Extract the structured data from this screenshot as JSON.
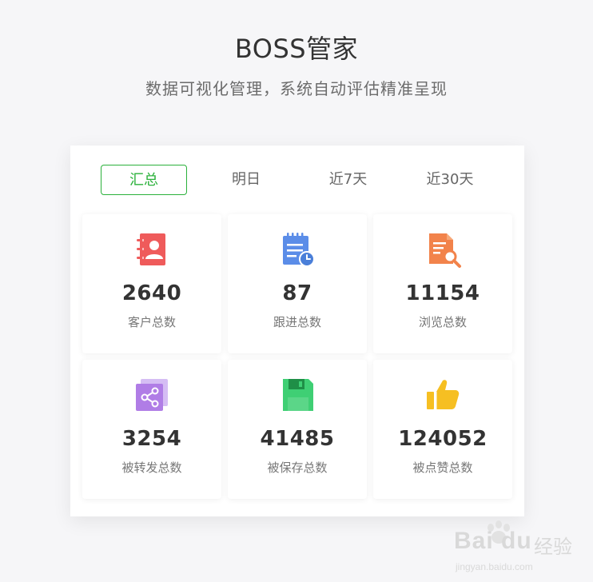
{
  "header": {
    "title": "BOSS管家",
    "subtitle": "数据可视化管理，系统自动评估精准呈现"
  },
  "tabs": [
    {
      "label": "汇总",
      "active": true
    },
    {
      "label": "明日",
      "active": false
    },
    {
      "label": "近7天",
      "active": false
    },
    {
      "label": "近30天",
      "active": false
    }
  ],
  "stats": [
    {
      "value": "2640",
      "label": "客户总数",
      "icon": "contacts-icon",
      "color": "#ef5b5b"
    },
    {
      "value": "87",
      "label": "跟进总数",
      "icon": "calendar-clock-icon",
      "color": "#5b8de8"
    },
    {
      "value": "11154",
      "label": "浏览总数",
      "icon": "document-search-icon",
      "color": "#f2834b"
    },
    {
      "value": "3254",
      "label": "被转发总数",
      "icon": "share-icon",
      "color": "#b07de6"
    },
    {
      "value": "41485",
      "label": "被保存总数",
      "icon": "save-icon",
      "color": "#3fcf74"
    },
    {
      "value": "124052",
      "label": "被点赞总数",
      "icon": "thumbs-up-icon",
      "color": "#f6bf22"
    }
  ],
  "colors": {
    "accent": "#2bb13b",
    "background": "#f6f6f8"
  },
  "watermark": {
    "brand": "Bai du",
    "suffix": "经验",
    "url": "jingyan.baidu.com"
  }
}
